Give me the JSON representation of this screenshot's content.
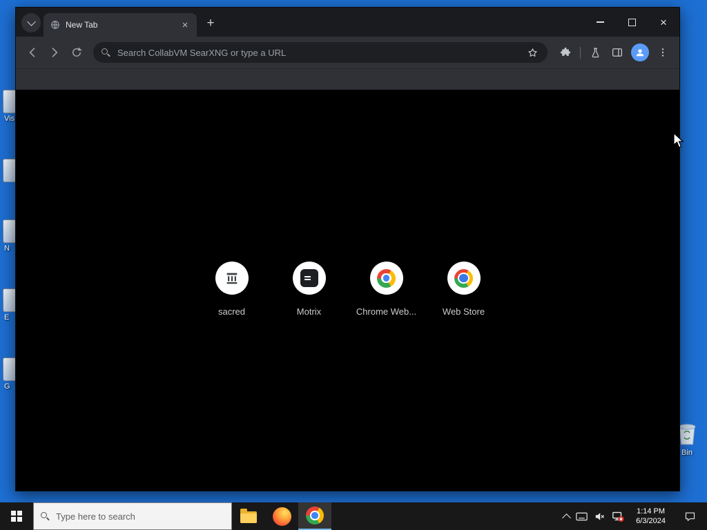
{
  "desktop": {
    "icons": [
      {
        "label": "Vis"
      },
      {
        "label": ""
      },
      {
        "label": "N"
      },
      {
        "label": "E"
      },
      {
        "label": "G"
      }
    ],
    "recycle_bin": {
      "label": "Bin"
    }
  },
  "browser": {
    "tab": {
      "title": "New Tab"
    },
    "glyphs": {
      "close_tab": "×",
      "new_tab": "+",
      "window_close": "×"
    },
    "omnibox": {
      "placeholder": "Search CollabVM SearXNG or type a URL"
    },
    "shortcuts": [
      {
        "label": "sacred"
      },
      {
        "label": "Motrix"
      },
      {
        "label": "Chrome Web..."
      },
      {
        "label": "Web Store"
      }
    ]
  },
  "taskbar": {
    "search": {
      "placeholder": "Type here to search"
    },
    "clock": {
      "time": "1:14 PM",
      "date": "6/3/2024"
    }
  },
  "colors": {
    "desktop_blue": "#1d6fd3",
    "taskbar_accent": "#76b9ed",
    "chrome_red": "#ea4335",
    "chrome_yellow": "#fbbc05",
    "chrome_green": "#34a853",
    "chrome_blue": "#4285f4"
  }
}
